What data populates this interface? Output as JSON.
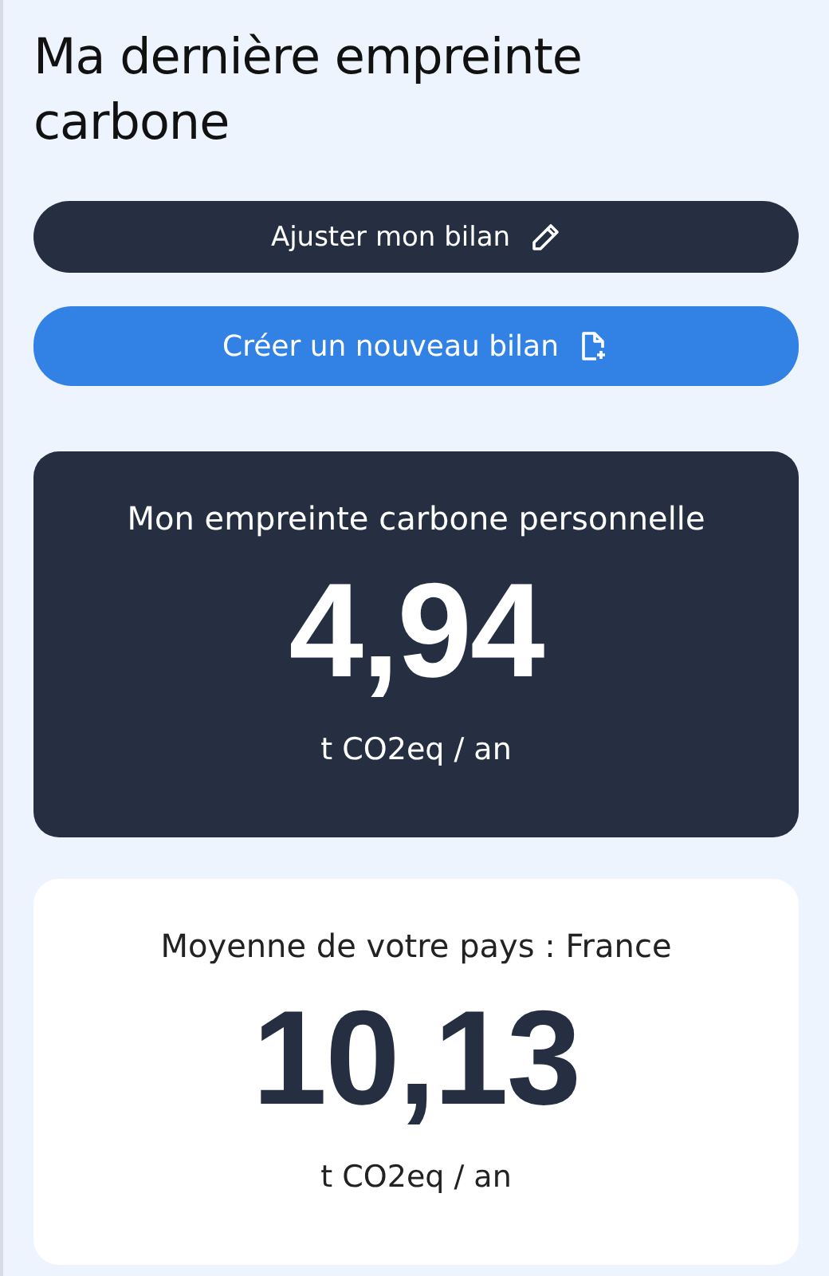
{
  "title": "Ma dernière empreinte carbone",
  "buttons": [
    {
      "label": "Ajuster mon bilan",
      "kind": "edit"
    },
    {
      "label": "Créer un nouveau bilan",
      "kind": "new"
    }
  ],
  "cards": [
    {
      "kind": "dark",
      "heading": "Mon empreinte carbone personnelle",
      "value": "4,94",
      "unit": "t CO2eq / an"
    },
    {
      "kind": "light",
      "heading": "Moyenne de votre pays : France",
      "value": "10,13",
      "unit": "t CO2eq / an"
    }
  ]
}
